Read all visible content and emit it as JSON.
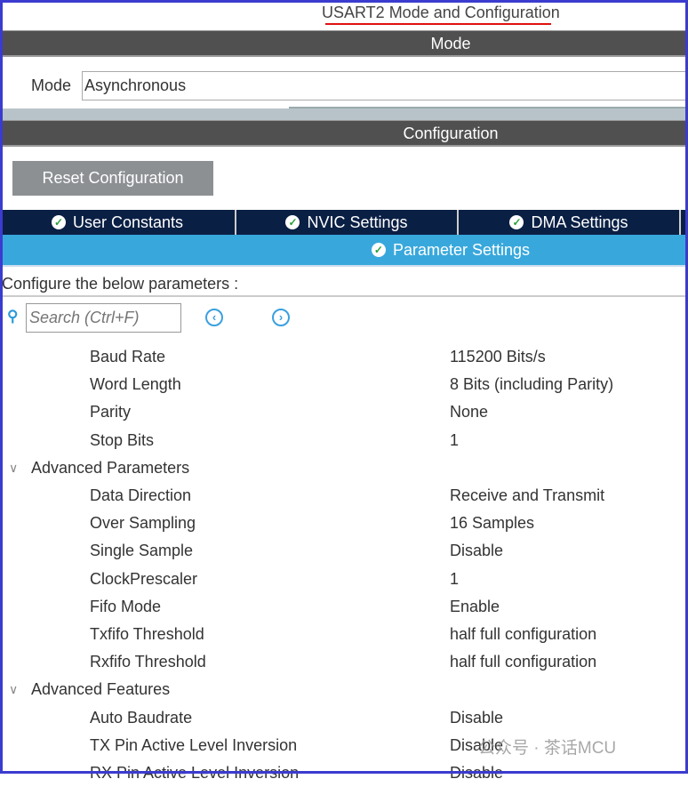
{
  "title": "USART2 Mode and Configuration",
  "mode_section": "Mode",
  "mode_label": "Mode",
  "mode_value": "Asynchronous",
  "config_section": "Configuration",
  "reset_button": "Reset Configuration",
  "tabs": [
    "User Constants",
    "NVIC Settings",
    "DMA Settings"
  ],
  "active_tab": "Parameter Settings",
  "configure_text": "Configure the below parameters :",
  "search_placeholder": "Search (Ctrl+F)",
  "rows": [
    {
      "name": "Baud Rate",
      "value": "115200 Bits/s"
    },
    {
      "name": "Word Length",
      "value": "8 Bits (including Parity)"
    },
    {
      "name": "Parity",
      "value": "None"
    },
    {
      "name": "Stop Bits",
      "value": "1"
    },
    {
      "group": "Advanced Parameters"
    },
    {
      "name": "Data Direction",
      "value": "Receive and Transmit"
    },
    {
      "name": "Over Sampling",
      "value": "16 Samples"
    },
    {
      "name": "Single Sample",
      "value": "Disable"
    },
    {
      "name": "ClockPrescaler",
      "value": "1"
    },
    {
      "name": "Fifo Mode",
      "value": "Enable"
    },
    {
      "name": "Txfifo Threshold",
      "value": "half full configuration"
    },
    {
      "name": "Rxfifo Threshold",
      "value": "half full configuration"
    },
    {
      "group": "Advanced Features"
    },
    {
      "name": "Auto Baudrate",
      "value": "Disable"
    },
    {
      "name": "TX Pin Active Level Inversion",
      "value": "Disable"
    },
    {
      "name": "RX Pin Active Level Inversion",
      "value": "Disable"
    }
  ],
  "watermark": "公众号 · 茶话MCU"
}
